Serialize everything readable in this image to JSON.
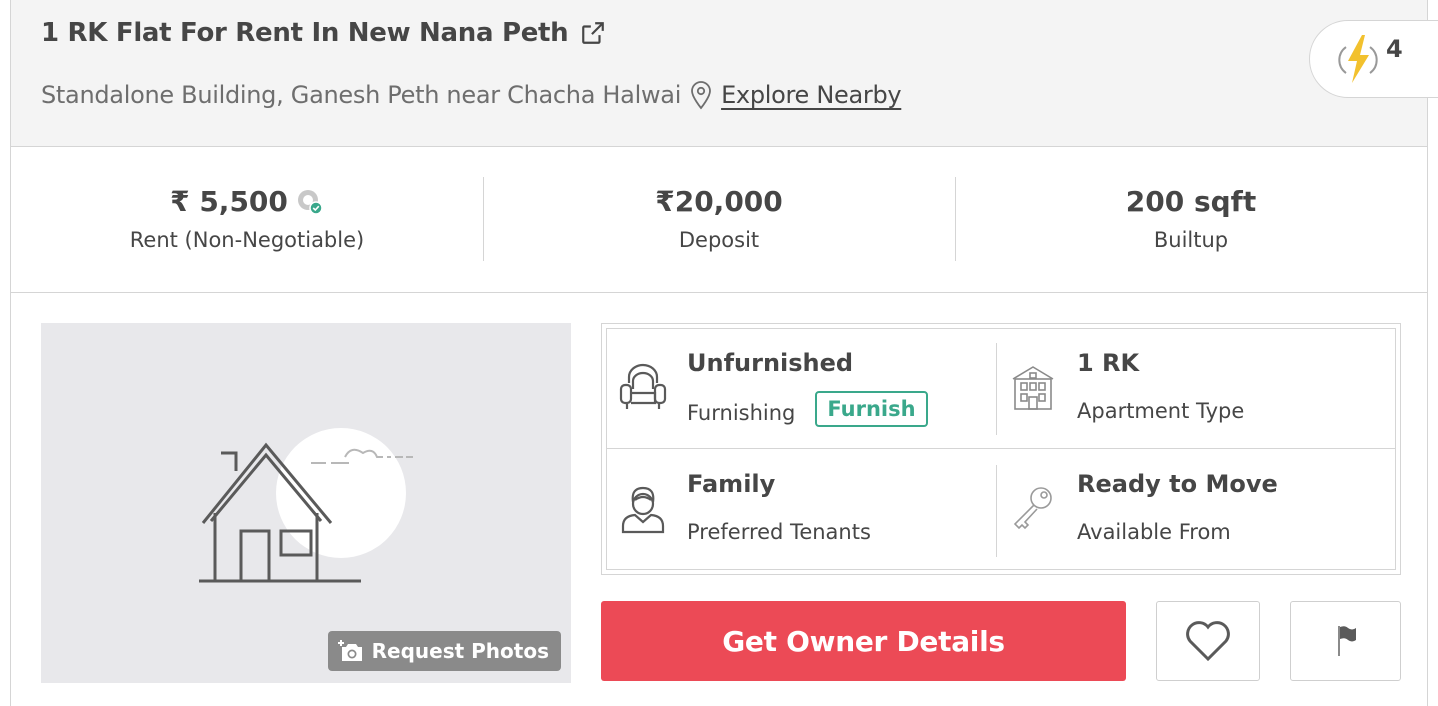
{
  "listing": {
    "title": "1 RK Flat For Rent In New Nana Peth",
    "address": "Standalone Building, Ganesh Peth near Chacha Halwai",
    "explore_label": "Explore Nearby",
    "boost_count": "4"
  },
  "stats": [
    {
      "value": "₹ 5,500",
      "label": "Rent (Non-Negotiable)"
    },
    {
      "value": "₹20,000",
      "label": "Deposit"
    },
    {
      "value": "200 sqft",
      "label": "Builtup"
    }
  ],
  "photo": {
    "request_label": "Request Photos"
  },
  "details": {
    "furnishing": {
      "value": "Unfurnished",
      "label": "Furnishing",
      "action": "Furnish"
    },
    "apartment": {
      "value": "1 RK",
      "label": "Apartment Type"
    },
    "tenants": {
      "value": "Family",
      "label": "Preferred Tenants"
    },
    "availability": {
      "value": "Ready to Move",
      "label": "Available From"
    }
  },
  "actions": {
    "owner_label": "Get Owner Details"
  },
  "icons": {
    "external_link": "external-link-icon",
    "location": "location-pin-icon",
    "boost": "lightning-bolt-icon",
    "verified": "verified-badge-icon",
    "sofa": "sofa-icon",
    "building": "building-icon",
    "person": "person-icon",
    "key": "key-icon",
    "camera": "camera-plus-icon",
    "heart": "heart-icon",
    "flag": "flag-icon"
  },
  "colors": {
    "primary_cta": "#ec4a56",
    "furnish_accent": "#3aa88b",
    "bolt": "#f2c12e"
  }
}
